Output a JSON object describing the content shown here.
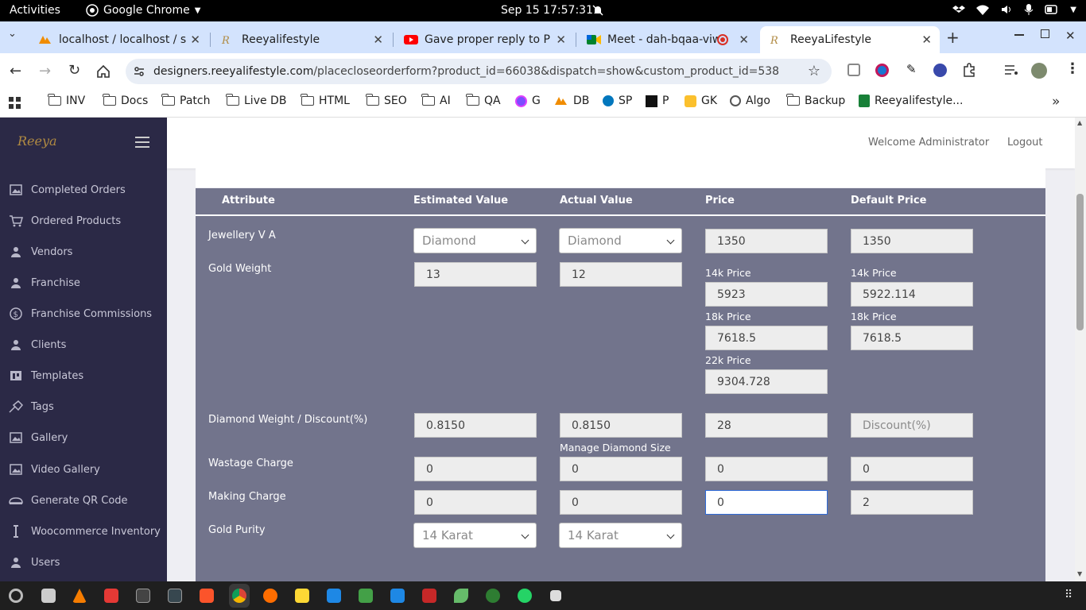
{
  "system_bar": {
    "activities": "Activities",
    "app_name": "Google Chrome",
    "clock": "Sep 15  17:57:31"
  },
  "tabs": [
    {
      "title": "localhost / localhost / s",
      "icon": "phpmyadmin-icon"
    },
    {
      "title": "Reeyalifestyle",
      "icon": "reeya-logo-icon"
    },
    {
      "title": "Gave proper reply to Pa",
      "icon": "youtube-icon"
    },
    {
      "title": "Meet - dah-bqaa-viw",
      "icon": "meet-icon"
    },
    {
      "title": "ReeyaLifestyle",
      "icon": "reeya-logo-icon",
      "active": true
    }
  ],
  "address_bar": {
    "host": "designers.reeyalifestyle.com",
    "path": "/placecloseorderform?product_id=66038&dispatch=show&custom_product_id=538"
  },
  "bookmarks": [
    "INV",
    "Docs",
    "Patch",
    "Live DB",
    "HTML",
    "SEO",
    "AI",
    "QA",
    "G",
    "DB",
    "SP",
    "P",
    "GK",
    "Algo",
    "Backup",
    "Reeyalifestyle..."
  ],
  "sidebar": {
    "logo": "Reeya",
    "items": [
      {
        "label": "Completed Orders",
        "icon": "image-icon"
      },
      {
        "label": "Ordered Products",
        "icon": "cart-icon"
      },
      {
        "label": "Vendors",
        "icon": "user-icon"
      },
      {
        "label": "Franchise",
        "icon": "user-icon"
      },
      {
        "label": "Franchise Commissions",
        "icon": "dollar-icon"
      },
      {
        "label": "Clients",
        "icon": "user-icon"
      },
      {
        "label": "Templates",
        "icon": "template-icon"
      },
      {
        "label": "Tags",
        "icon": "tag-icon"
      },
      {
        "label": "Gallery",
        "icon": "image-icon"
      },
      {
        "label": "Video Gallery",
        "icon": "image-icon"
      },
      {
        "label": "Generate QR Code",
        "icon": "qr-icon"
      },
      {
        "label": "Woocommerce Inventory",
        "icon": "bar-icon"
      },
      {
        "label": "Users",
        "icon": "user-icon"
      }
    ]
  },
  "header": {
    "welcome": "Welcome Administrator",
    "logout": "Logout"
  },
  "table": {
    "headers": {
      "attribute": "Attribute",
      "estimated": "Estimated Value",
      "actual": "Actual Value",
      "price": "Price",
      "default_price": "Default Price"
    },
    "jewellery": {
      "label": "Jewellery V A",
      "estimated": "Diamond",
      "actual": "Diamond",
      "price": "1350",
      "default_price": "1350"
    },
    "gold_weight": {
      "label": "Gold Weight",
      "estimated": "13",
      "actual": "12",
      "k14_label": "14k Price",
      "k14_price": "5923",
      "k14_default": "5922.114",
      "k18_label": "18k Price",
      "k18_price": "7618.5",
      "k18_default": "7618.5",
      "k22_label": "22k Price",
      "k22_price": "9304.728"
    },
    "diamond": {
      "label": "Diamond Weight / Discount(%)",
      "estimated": "0.8150",
      "actual": "0.8150",
      "price": "28",
      "default_placeholder": "Discount(%)",
      "manage_link": "Manage Diamond Size"
    },
    "wastage": {
      "label": "Wastage Charge",
      "estimated": "0",
      "actual": "0",
      "price": "0",
      "default_price": "0"
    },
    "making": {
      "label": "Making Charge",
      "estimated": "0",
      "actual": "0",
      "price": "0",
      "default_price": "2"
    },
    "purity": {
      "label": "Gold Purity",
      "estimated": "14 Karat",
      "actual": "14 Karat"
    }
  },
  "colors": {
    "sidebar_bg": "#2b2946",
    "panel_bg": "#72748c",
    "tab_strip": "#d3e3fd",
    "accent_focus": "#2f6bd8"
  }
}
